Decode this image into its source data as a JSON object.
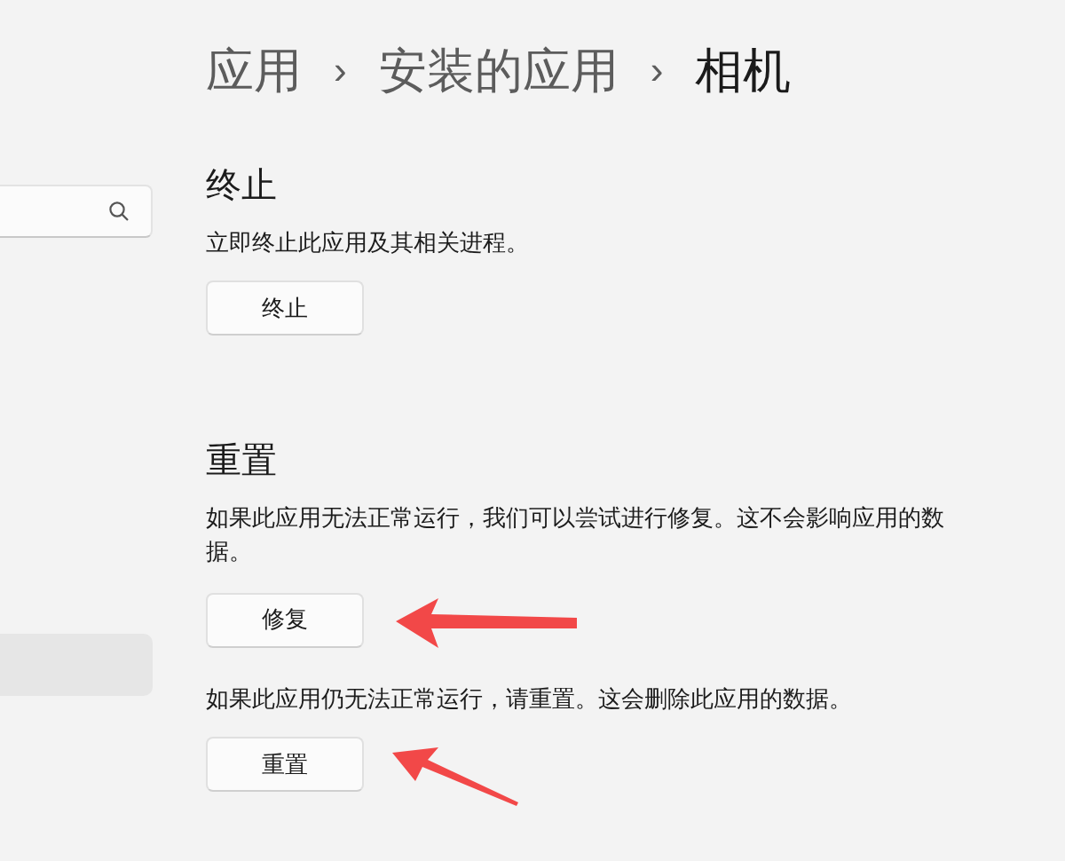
{
  "sidebar": {
    "search_field": {
      "kind": "search"
    },
    "items": [
      {
        "selected": true
      }
    ]
  },
  "breadcrumb": [
    {
      "label": "应用",
      "current": false
    },
    {
      "label": "安装的应用",
      "current": false
    },
    {
      "label": "相机",
      "current": true
    }
  ],
  "breadcrumb_separator": "›",
  "sections": [
    {
      "title": "终止",
      "blocks": [
        {
          "description": "立即终止此应用及其相关进程。",
          "button": "终止",
          "kind": "plain"
        }
      ]
    },
    {
      "title": "重置",
      "blocks": [
        {
          "description": "如果此应用无法正常运行，我们可以尝试进行修复。这不会影响应用的数据。",
          "button": "修复",
          "kind": "arrow-left"
        },
        {
          "description": "如果此应用仍无法正常运行，请重置。这会删除此应用的数据。",
          "button": "重置",
          "kind": "arrow-up-left"
        }
      ]
    }
  ]
}
